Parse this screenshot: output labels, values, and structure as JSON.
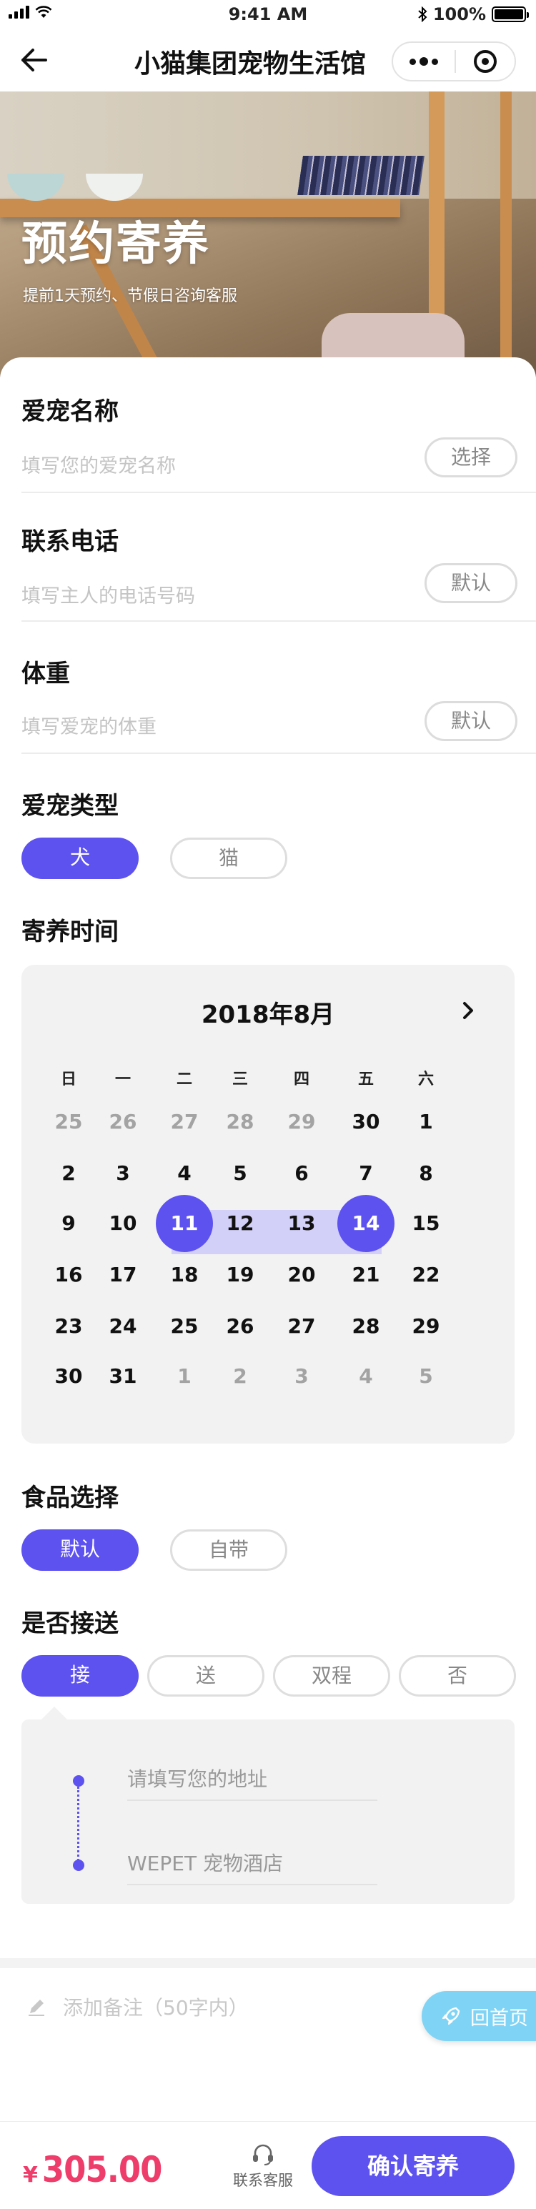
{
  "status_bar": {
    "time": "9:41 AM",
    "battery": "100%"
  },
  "nav": {
    "title": "小猫集团宠物生活馆"
  },
  "hero": {
    "title": "预约寄养",
    "subtitle": "提前1天预约、节假日咨询客服"
  },
  "form": {
    "pet_name": {
      "label": "爱宠名称",
      "placeholder": "填写您的爱宠名称",
      "button": "选择"
    },
    "phone": {
      "label": "联系电话",
      "placeholder": "填写主人的电话号码",
      "button": "默认"
    },
    "weight": {
      "label": "体重",
      "placeholder": "填写爱宠的体重",
      "button": "默认"
    }
  },
  "pet_type": {
    "title": "爱宠类型",
    "options": [
      "犬",
      "猫"
    ],
    "selected": "犬"
  },
  "boarding_time": {
    "title": "寄养时间",
    "calendar": {
      "month_label": "2018年8月",
      "weekdays": [
        "日",
        "一",
        "二",
        "三",
        "四",
        "五",
        "六"
      ],
      "weeks": [
        [
          "25",
          "26",
          "27",
          "28",
          "29",
          "30",
          "1"
        ],
        [
          "2",
          "3",
          "4",
          "5",
          "6",
          "7",
          "8"
        ],
        [
          "9",
          "10",
          "11",
          "12",
          "13",
          "14",
          "15"
        ],
        [
          "16",
          "17",
          "18",
          "19",
          "20",
          "21",
          "22"
        ],
        [
          "23",
          "24",
          "25",
          "26",
          "27",
          "28",
          "29"
        ],
        [
          "30",
          "31",
          "1",
          "2",
          "3",
          "4",
          "5"
        ]
      ],
      "range_start": "11",
      "range_end": "14"
    }
  },
  "food": {
    "title": "食品选择",
    "options": [
      "默认",
      "自带"
    ],
    "selected": "默认"
  },
  "transport": {
    "title": "是否接送",
    "options": [
      "接",
      "送",
      "双程",
      "否"
    ],
    "selected": "接",
    "address_placeholder": "请填写您的地址",
    "destination": "WEPET 宠物酒店"
  },
  "note": {
    "placeholder": "添加备注（50字内）"
  },
  "home_button": {
    "label": "回首页"
  },
  "bottom_bar": {
    "currency": "¥",
    "price": "305.00",
    "service_label": "联系客服",
    "confirm_label": "确认寄养"
  },
  "colors": {
    "accent": "#5d52f0",
    "price": "#ee3d6a",
    "home_button": "#7fd3f4",
    "range_fill": "#d2cff8"
  }
}
